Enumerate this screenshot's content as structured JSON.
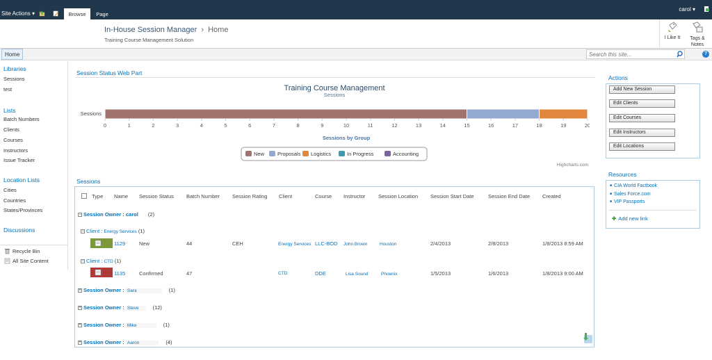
{
  "topbar": {
    "site_actions": "Site Actions",
    "tabs": [
      "Browse",
      "Page"
    ],
    "user": "carol"
  },
  "header": {
    "site_title": "In-House Session Manager",
    "separator": "›",
    "page": "Home",
    "description": "Training Course Management Solution",
    "like_it": "I Like It",
    "tags_notes": "Tags & Notes"
  },
  "nav": {
    "home": "Home",
    "search_placeholder": "Search this site..."
  },
  "leftnav": {
    "libraries_heading": "Libraries",
    "libraries": [
      "Sessions",
      "test"
    ],
    "lists_heading": "Lists",
    "lists": [
      "Batch Numbers",
      "Clients",
      "Courses",
      "Instructors",
      "Issue Tracker"
    ],
    "location_heading": "Location Lists",
    "location_lists": [
      "Cities",
      "Countries",
      "States/Provinces"
    ],
    "discussions_heading": "Discussions",
    "recycle_bin": "Recycle Bin",
    "all_site_content": "All Site Content"
  },
  "status_webpart": {
    "title": "Session Status Web Part",
    "credit": "Highcharts.com"
  },
  "chart_data": {
    "type": "bar",
    "orientation": "horizontal",
    "stacked": true,
    "title": "Training Course Management",
    "subtitle": "Sessions",
    "categories": [
      "Sessions"
    ],
    "xlabel": "Sessions by Group",
    "xlim": [
      0,
      20
    ],
    "ticks": [
      "0",
      "1",
      "2",
      "3",
      "4",
      "5",
      "6",
      "7",
      "8",
      "9",
      "10",
      "11",
      "12",
      "13",
      "14",
      "15",
      "16",
      "17",
      "18",
      "19",
      "20"
    ],
    "series": [
      {
        "name": "New",
        "values": [
          15
        ],
        "color": "#a0736e"
      },
      {
        "name": "Proposals",
        "values": [
          3
        ],
        "color": "#94a9cf"
      },
      {
        "name": "Logistics",
        "values": [
          2
        ],
        "color": "#e0873d"
      },
      {
        "name": "In Progress",
        "values": [
          0
        ],
        "color": "#3d9aa6"
      },
      {
        "name": "Accounting",
        "values": [
          0
        ],
        "color": "#7e62a0"
      }
    ],
    "legend_position": "bottom-center"
  },
  "sessions": {
    "title": "Sessions",
    "columns": [
      "Type",
      "Name",
      "Session Status",
      "Batch Number",
      "Session Rating",
      "Client",
      "Course",
      "Instructor",
      "Session Location",
      "Session Start Date",
      "Session End Date",
      "Created"
    ],
    "owner_label": "Session Owner :",
    "client_label": "Client :",
    "groups": [
      {
        "owner": "carol",
        "count": "(2)"
      },
      {
        "owner": "Sara",
        "count": "(1)"
      },
      {
        "owner": "Steve",
        "count": "(12)"
      },
      {
        "owner": "Mike",
        "count": "(1)"
      },
      {
        "owner": "Aaron",
        "count": "(4)"
      }
    ],
    "subgroups": [
      {
        "client": "Energy Services",
        "count": "(1)"
      },
      {
        "client": "CTD",
        "count": "(1)"
      }
    ],
    "rows": [
      {
        "name": "1129",
        "status": "New",
        "batch": "44",
        "rating": "CEH",
        "client": "Energy Services",
        "course": "LLC-BOD",
        "instructor": "John Brown",
        "location": "Houston",
        "start": "2/4/2013",
        "end": "2/8/2013",
        "created": "1/8/2013 8:59 AM",
        "badge_color": "#7a9a3a"
      },
      {
        "name": "1135",
        "status": "Confirmed",
        "batch": "47",
        "rating": "",
        "client": "CTD",
        "course": "DDE",
        "instructor": "Lisa Sound",
        "location": "Phoenix",
        "start": "1/5/2013",
        "end": "1/6/2013",
        "created": "1/8/2013 9:00 AM",
        "badge_color": "#b03a3a"
      }
    ]
  },
  "actions": {
    "title": "Actions",
    "buttons": [
      "Add New Session",
      "Edit Clients",
      "Edit Courses",
      "Edit Instructors",
      "Edit Locations"
    ]
  },
  "resources": {
    "title": "Resources",
    "links": [
      "CIA World Factbook",
      "Sales Force.com",
      "VIP Passports"
    ],
    "add_new": "Add new link"
  }
}
